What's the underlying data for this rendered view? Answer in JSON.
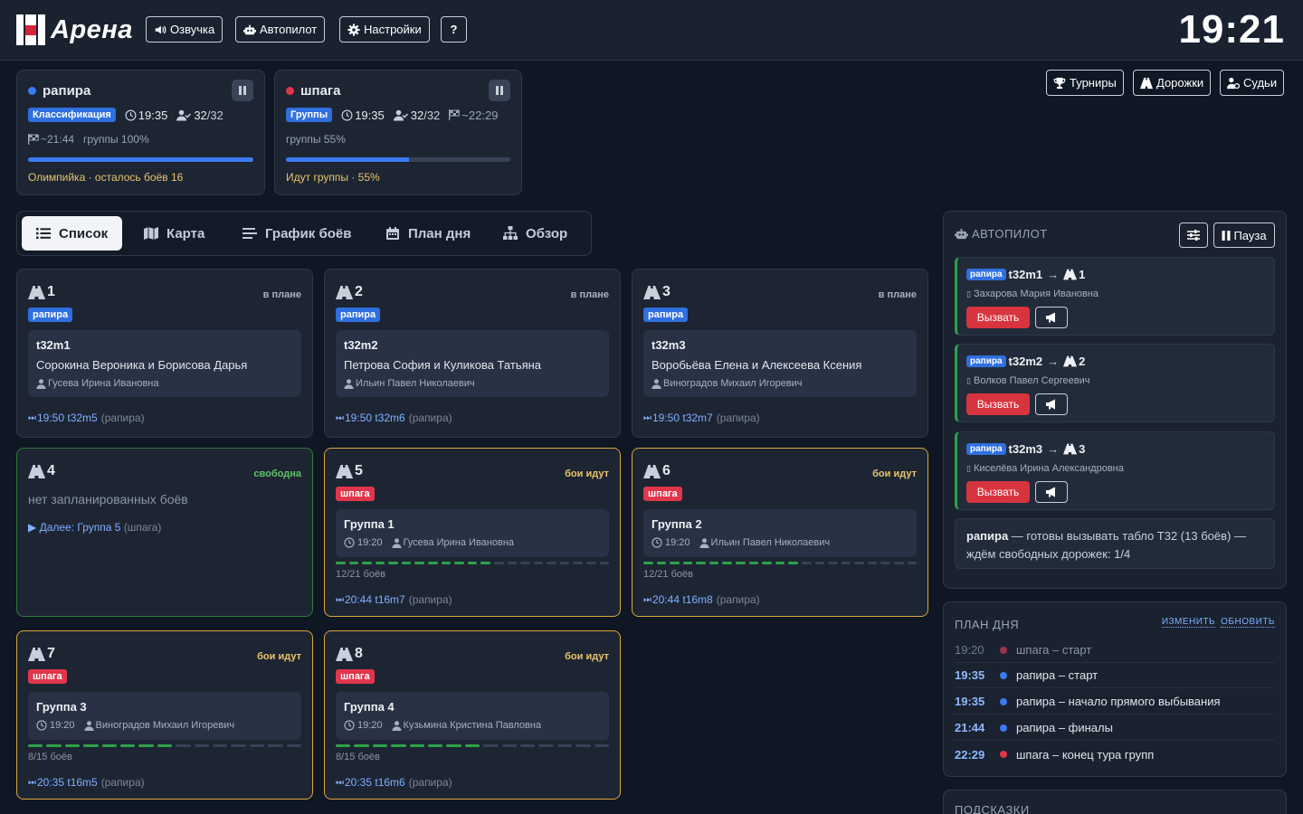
{
  "header": {
    "logo_text": "Арена",
    "buttons": {
      "voice": "Озвучка",
      "autopilot": "Автопилот",
      "settings": "Настройки",
      "help": "?"
    },
    "clock": "19:21"
  },
  "events": [
    {
      "name": "рапира",
      "color": "#3b7af0",
      "stage": "Классификация",
      "stage_color": "blue",
      "time": "19:35",
      "checked": "32",
      "total": "/32",
      "finish": "~21:44",
      "line2": "группы 100%",
      "progress": 1.0,
      "footer": "Олимпийка · осталось боёв 16"
    },
    {
      "name": "шпага",
      "color": "#e0364c",
      "stage": "Группы",
      "stage_color": "blue",
      "time": "19:35",
      "checked": "32",
      "total": "/32",
      "finish": "~22:29",
      "line2": "группы 55%",
      "progress": 0.55,
      "footer": "Идут группы · 55%"
    }
  ],
  "right_buttons": {
    "tournaments": "Турниры",
    "lanes": "Дорожки",
    "judges": "Судьи"
  },
  "tabs": [
    {
      "label": "Список",
      "icon": "list-icon",
      "active": true
    },
    {
      "label": "Карта",
      "icon": "map-icon",
      "active": false
    },
    {
      "label": "График боёв",
      "icon": "schedule-icon",
      "active": false
    },
    {
      "label": "План дня",
      "icon": "calendar-icon",
      "active": false
    },
    {
      "label": "Обзор",
      "icon": "overview-icon",
      "active": false
    }
  ],
  "lanes": [
    {
      "num": "1",
      "status": "в плане",
      "weapon": "рапира",
      "bout": "t32m1",
      "fencers": "Сорокина Вероника и Борисова Дарья",
      "referee": "Гусева Ирина Ивановна",
      "next_time": "19:50 t32m5",
      "next_weapon": "(рапира)"
    },
    {
      "num": "2",
      "status": "в плане",
      "weapon": "рапира",
      "bout": "t32m2",
      "fencers": "Петрова София и Куликова Татьяна",
      "referee": "Ильин Павел Николаевич",
      "next_time": "19:50 t32m6",
      "next_weapon": "(рапира)"
    },
    {
      "num": "3",
      "status": "в плане",
      "weapon": "рапира",
      "bout": "t32m3",
      "fencers": "Воробьёва Елена и Алексеева Ксения",
      "referee": "Виноградов Михаил Игоревич",
      "next_time": "19:50 t32m7",
      "next_weapon": "(рапира)"
    },
    {
      "num": "4",
      "status": "свободна",
      "note": "нет запланированных боёв",
      "next_label": "▶ Далее: Группа 5",
      "next_weapon": "(шпага)"
    },
    {
      "num": "5",
      "status": "бои идут",
      "weapon": "шпага",
      "group": "Группа 1",
      "time": "19:20",
      "referee": "Гусева Ирина Ивановна",
      "done": 12,
      "total": 21,
      "count": "12/21 боёв",
      "next_time": "20:44 t16m7",
      "next_weapon": "(рапира)"
    },
    {
      "num": "6",
      "status": "бои идут",
      "weapon": "шпага",
      "group": "Группа 2",
      "time": "19:20",
      "referee": "Ильин Павел Николаевич",
      "done": 12,
      "total": 21,
      "count": "12/21 боёв",
      "next_time": "20:44 t16m8",
      "next_weapon": "(рапира)"
    },
    {
      "num": "7",
      "status": "бои идут",
      "weapon": "шпага",
      "group": "Группа 3",
      "time": "19:20",
      "referee": "Виноградов Михаил Игоревич",
      "done": 8,
      "total": 15,
      "count": "8/15 боёв",
      "next_time": "20:35 t16m5",
      "next_weapon": "(рапира)"
    },
    {
      "num": "8",
      "status": "бои идут",
      "weapon": "шпага",
      "group": "Группа 4",
      "time": "19:20",
      "referee": "Кузьмина Кристина Павловна",
      "done": 8,
      "total": 15,
      "count": "8/15 боёв",
      "next_time": "20:35 t16m6",
      "next_weapon": "(рапира)"
    }
  ],
  "autopilot": {
    "title": "АВТОПИЛОТ",
    "pause_label": "Пауза",
    "call_label": "Вызвать",
    "calls": [
      {
        "weapon": "рапира",
        "bout": "t32m1",
        "lane": "1",
        "referee": "Захарова Мария Ивановна"
      },
      {
        "weapon": "рапира",
        "bout": "t32m2",
        "lane": "2",
        "referee": "Волков Павел Сергеевич"
      },
      {
        "weapon": "рапира",
        "bout": "t32m3",
        "lane": "3",
        "referee": "Киселёва Ирина Александровна"
      }
    ],
    "note_bold": "рапира",
    "note_text": " — готовы вызывать табло Т32 (13 боёв) — ждём свободных дорожек: 1/4"
  },
  "day_plan": {
    "title": "ПЛАН ДНЯ",
    "edit": "ИЗМЕНИТЬ",
    "refresh": "ОБНОВИТЬ",
    "rows": [
      {
        "time": "19:20",
        "color": "#9b3346",
        "text": "шпага – старт",
        "past": true
      },
      {
        "time": "19:35",
        "color": "#3b7af0",
        "text": "рапира – старт",
        "past": false
      },
      {
        "time": "19:35",
        "color": "#3b7af0",
        "text": "рапира – начало прямого выбывания",
        "past": false
      },
      {
        "time": "21:44",
        "color": "#3b7af0",
        "text": "рапира – финалы",
        "past": false
      },
      {
        "time": "22:29",
        "color": "#e0364c",
        "text": "шпага – конец тура групп",
        "past": false
      }
    ]
  },
  "hints": {
    "title": "ПОДСКАЗКИ"
  }
}
